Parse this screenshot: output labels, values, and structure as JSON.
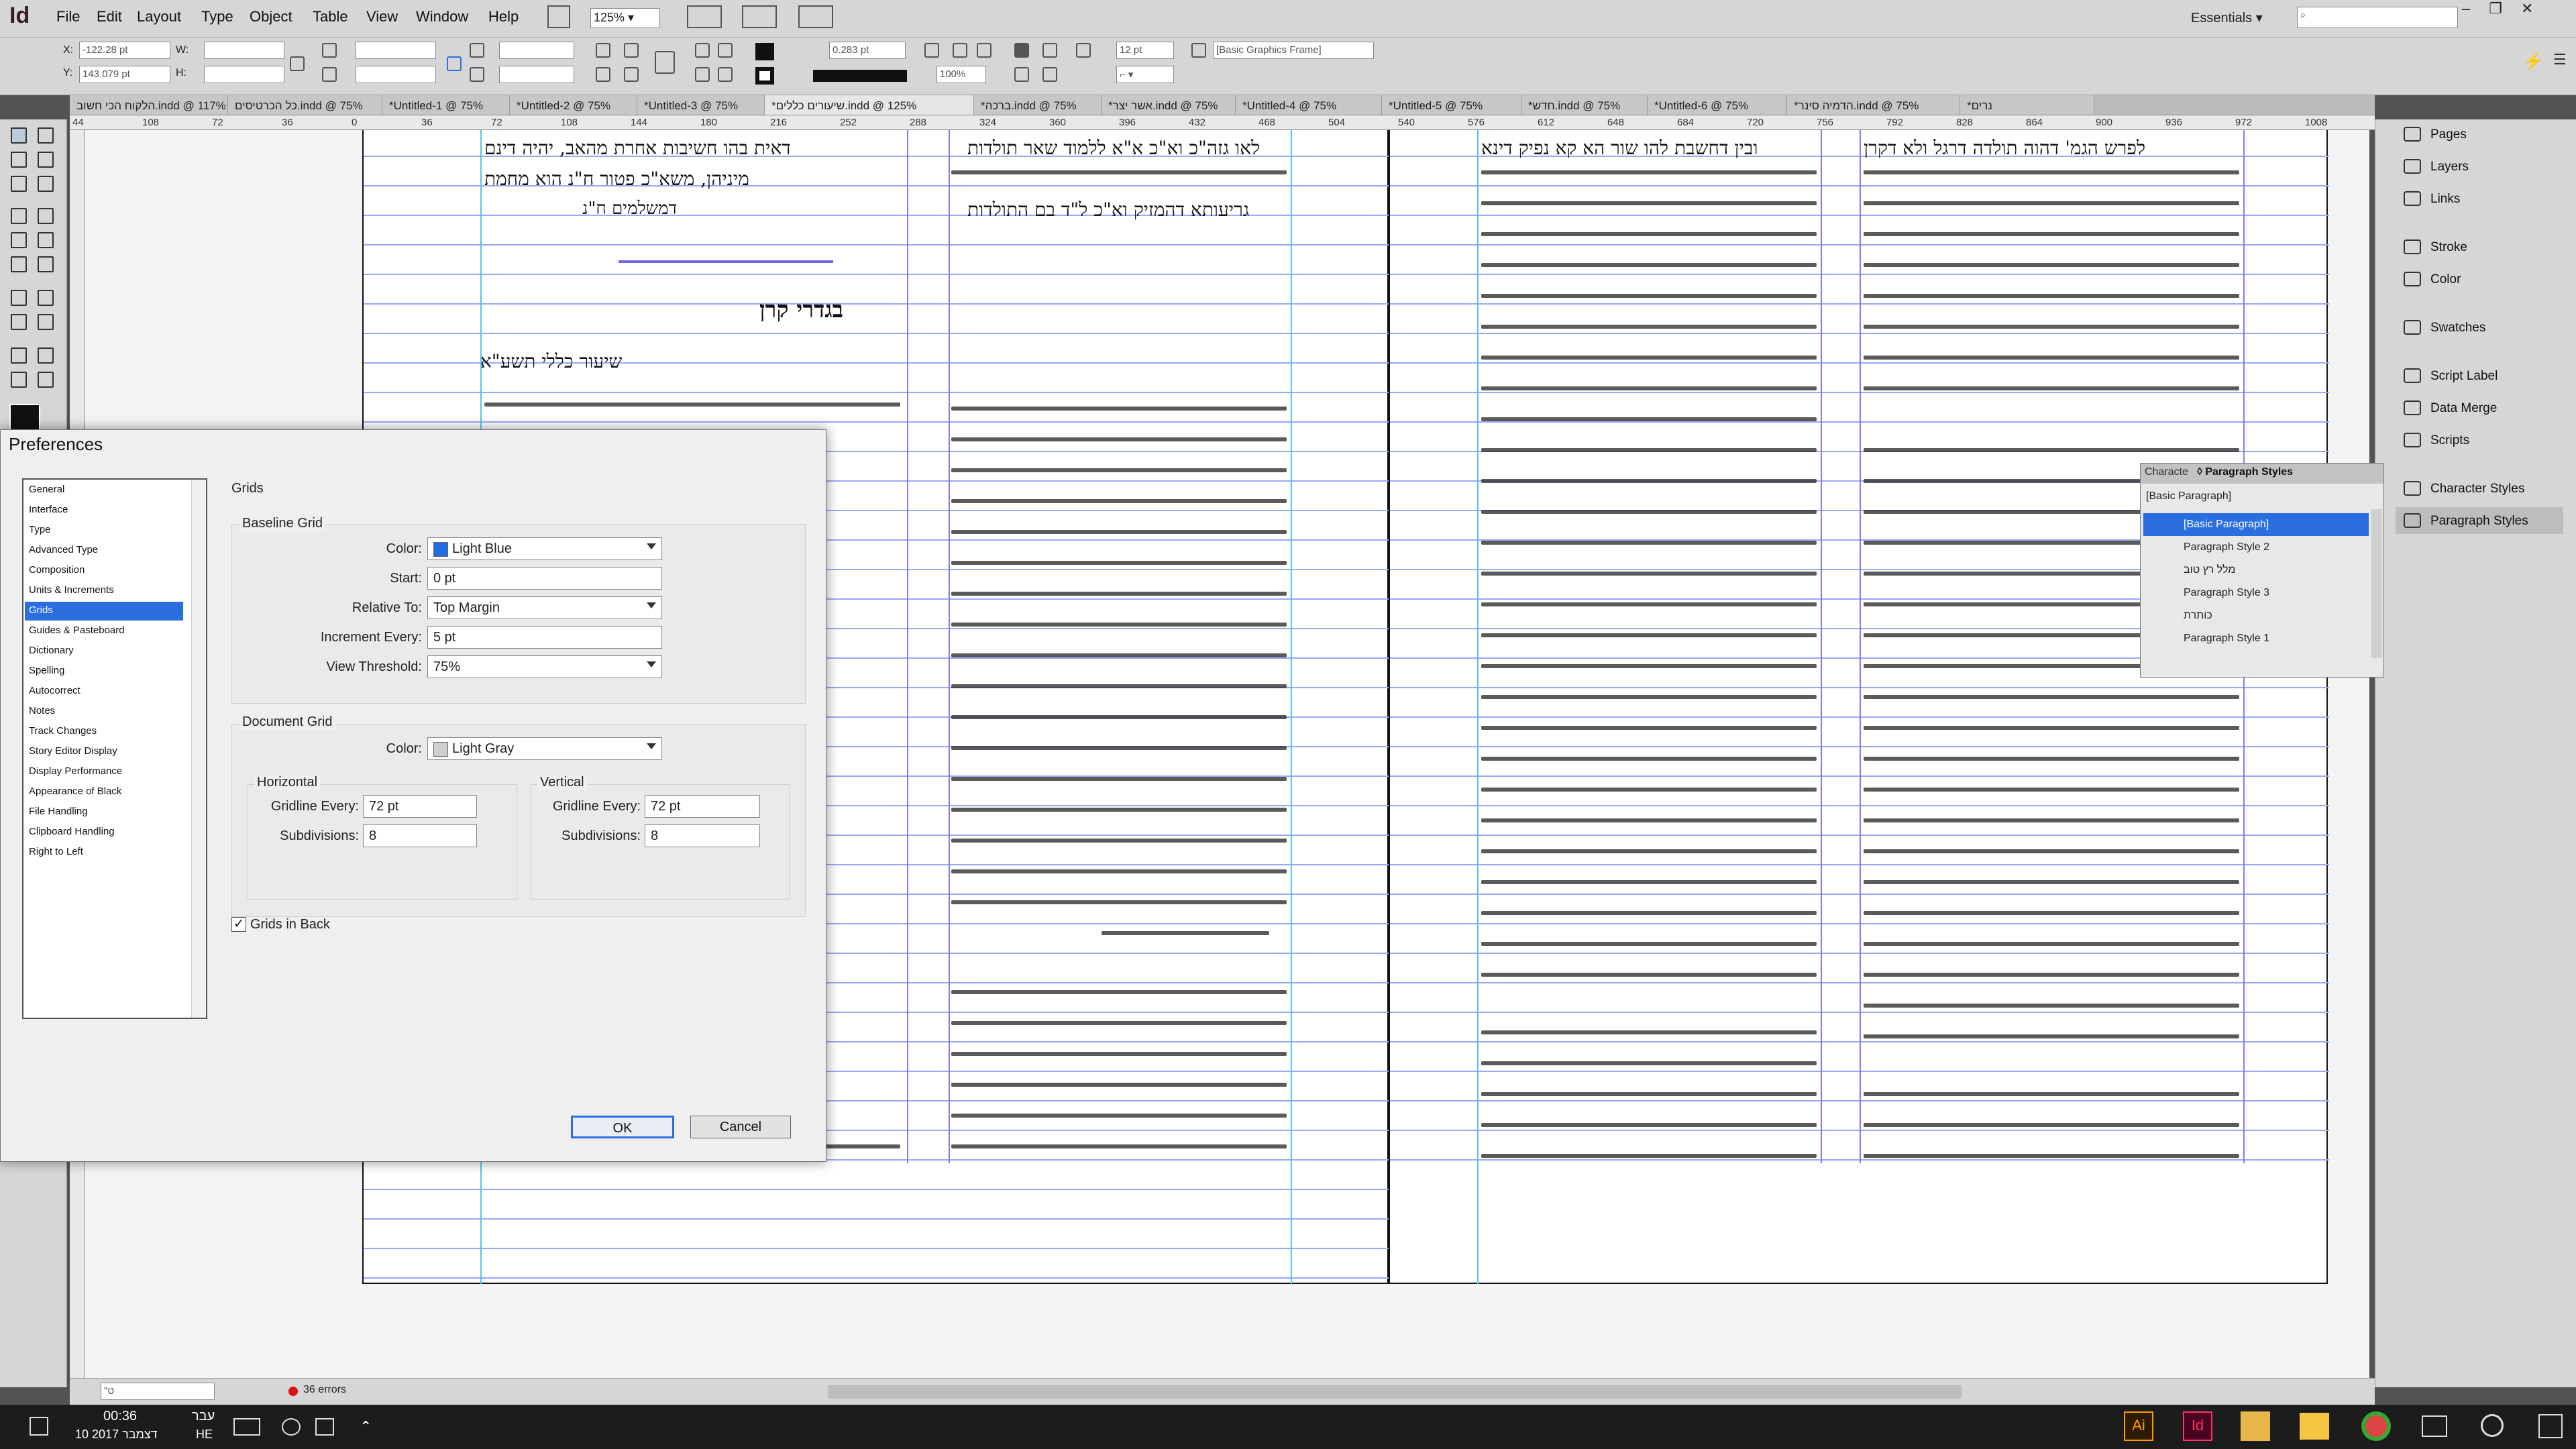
{
  "app": {
    "logo": "Id",
    "workspace": "Essentials"
  },
  "menubar": {
    "items": [
      "File",
      "Edit",
      "Layout",
      "Type",
      "Object",
      "Table",
      "View",
      "Window",
      "Help"
    ],
    "zoom": "125%"
  },
  "control": {
    "x": "-122.28 pt",
    "y": "143.079 pt",
    "stroke_weight": "0.283 pt",
    "scale": "100%",
    "tint": "12 pt",
    "object_style": "[Basic Graphics Frame]"
  },
  "tabs": [
    "הלקוח הכי חשוב.indd @ 117%",
    "כל הכרטיסים.indd @ 75%",
    "*Untitled-1 @ 75%",
    "*Untitled-2 @ 75%",
    "*Untitled-3 @ 75%",
    "*שיעורים כללים.indd @ 125%",
    "*ברכה.indd @ 75%",
    "*אשר יצר.indd @ 75%",
    "*Untitled-4 @ 75%",
    "*Untitled-5 @ 75%",
    "*חדש.indd @ 75%",
    "*Untitled-6 @ 75%",
    "*הדמיה סינר.indd @ 75%",
    "*נרים"
  ],
  "ruler_marks": [
    "44",
    "108",
    "72",
    "36",
    "0",
    "36",
    "72",
    "108",
    "144",
    "180",
    "216",
    "252",
    "288",
    "324",
    "360",
    "396",
    "432",
    "468",
    "504",
    "540",
    "576",
    "612",
    "648",
    "684",
    "720",
    "756",
    "792",
    "828",
    "864",
    "900",
    "936",
    "972",
    "1008"
  ],
  "document": {
    "heading": "בגדרי קרן",
    "subheading": "שיעור כללי תשע\"א",
    "left_top_line": "דאית בהו חשיבות אחרת מהאב, יהיה דינם",
    "left_second_line": "מיניהן, משא\"כ פטור ח\"נ הוא מחמת",
    "left_sig": "דמשלמים ח\"נ",
    "right_top_line": "לאו גזה\"כ וא\"כ א\"א ללמוד שאר תולדות",
    "right_third": "גריעותא דהמזיק וא\"כ ל\"ד בם התולדות",
    "page2_top_left": "ובין דחשבת להו שור הא קא נפיק דינא",
    "page2_top_right": "לפרש הגמ' דהוה תולדה דרגל ולא דקרן"
  },
  "panels": {
    "items": [
      "Pages",
      "Layers",
      "Links",
      "Stroke",
      "Color",
      "Swatches",
      "Script Label",
      "Data Merge",
      "Scripts",
      "Character Styles",
      "Paragraph Styles"
    ]
  },
  "paragraph_styles": {
    "tab_character": "Characte",
    "tab_paragraph": "◊ Paragraph Styles",
    "current": "[Basic Paragraph]",
    "items": [
      "[Basic Paragraph]",
      "Paragraph Style 2",
      "מלל רץ טוב",
      "Paragraph Style 3",
      "כותרת",
      "Paragraph Style 1"
    ]
  },
  "status": {
    "page": "\"ט",
    "errors": "36 errors"
  },
  "taskbar": {
    "time": "00:36",
    "date": "10 דצמבר 2017",
    "lang_top": "עבר",
    "lang_bottom": "HE"
  },
  "dialog": {
    "title": "Preferences",
    "categories": [
      "General",
      "Interface",
      "Type",
      "Advanced Type",
      "Composition",
      "Units & Increments",
      "Grids",
      "Guides & Pasteboard",
      "Dictionary",
      "Spelling",
      "Autocorrect",
      "Notes",
      "Track Changes",
      "Story Editor Display",
      "Display Performance",
      "Appearance of Black",
      "File Handling",
      "Clipboard Handling",
      "Right to Left"
    ],
    "selected_category": "Grids",
    "section_title": "Grids",
    "baseline": {
      "title": "Baseline Grid",
      "color_label": "Color:",
      "color": "Light Blue",
      "color_hex": "#1f6fe0",
      "start_label": "Start:",
      "start": "0 pt",
      "relative_label": "Relative To:",
      "relative": "Top Margin",
      "increment_label": "Increment Every:",
      "increment": "5 pt",
      "threshold_label": "View Threshold:",
      "threshold": "75%"
    },
    "document_grid": {
      "title": "Document Grid",
      "color_label": "Color:",
      "color": "Light Gray",
      "color_hex": "#cfcfcf",
      "horizontal": {
        "title": "Horizontal",
        "gridline_label": "Gridline Every:",
        "gridline": "72 pt",
        "subdiv_label": "Subdivisions:",
        "subdivisions": "8"
      },
      "vertical": {
        "title": "Vertical",
        "gridline_label": "Gridline Every:",
        "gridline": "72 pt",
        "subdiv_label": "Subdivisions:",
        "subdivisions": "8"
      }
    },
    "grids_in_back": "Grids in Back",
    "ok": "OK",
    "cancel": "Cancel"
  }
}
